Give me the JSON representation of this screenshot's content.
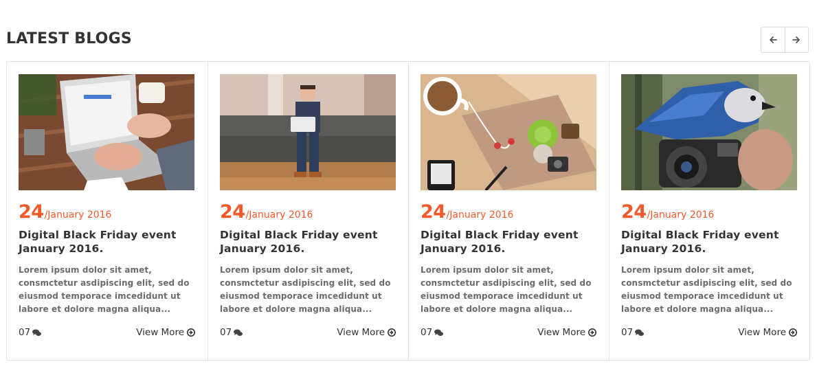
{
  "section": {
    "title": "LATEST BLOGS"
  },
  "colors": {
    "accent": "#f15a29",
    "title": "#333333",
    "text": "#6b6b6b",
    "border": "#e3e3e3"
  },
  "nav": {
    "prev_icon": "arrow-left-icon",
    "next_icon": "arrow-right-icon"
  },
  "posts": [
    {
      "image": "laptop-desk-photo",
      "day": "24",
      "month": "/January 2016",
      "title": "Digital Black Friday event January 2016.",
      "excerpt": "Lorem ipsum dolor sit amet, consmctetur asdipiscing elit, sed do eiusmod temporace imcedidunt ut labore et dolore magna aliqua...",
      "comments": "07",
      "view_more": "View More"
    },
    {
      "image": "man-on-sofa-photo",
      "day": "24",
      "month": "/January 2016",
      "title": "Digital Black Friday event January 2016.",
      "excerpt": "Lorem ipsum dolor sit amet, consmctetur asdipiscing elit, sed do eiusmod temporace imcedidunt ut labore et dolore magna aliqua...",
      "comments": "07",
      "view_more": "View More"
    },
    {
      "image": "coffee-flatlay-photo",
      "day": "24",
      "month": "/January 2016",
      "title": "Digital Black Friday event January 2016.",
      "excerpt": "Lorem ipsum dolor sit amet, consmctetur asdipiscing elit, sed do eiusmod temporace imcedidunt ut labore et dolore magna aliqua...",
      "comments": "07",
      "view_more": "View More"
    },
    {
      "image": "bird-camera-photo",
      "day": "24",
      "month": "/January 2016",
      "title": "Digital Black Friday event January 2016.",
      "excerpt": "Lorem ipsum dolor sit amet, consmctetur asdipiscing elit, sed do eiusmod temporace imcedidunt ut labore et dolore magna aliqua...",
      "comments": "07",
      "view_more": "View More"
    }
  ]
}
